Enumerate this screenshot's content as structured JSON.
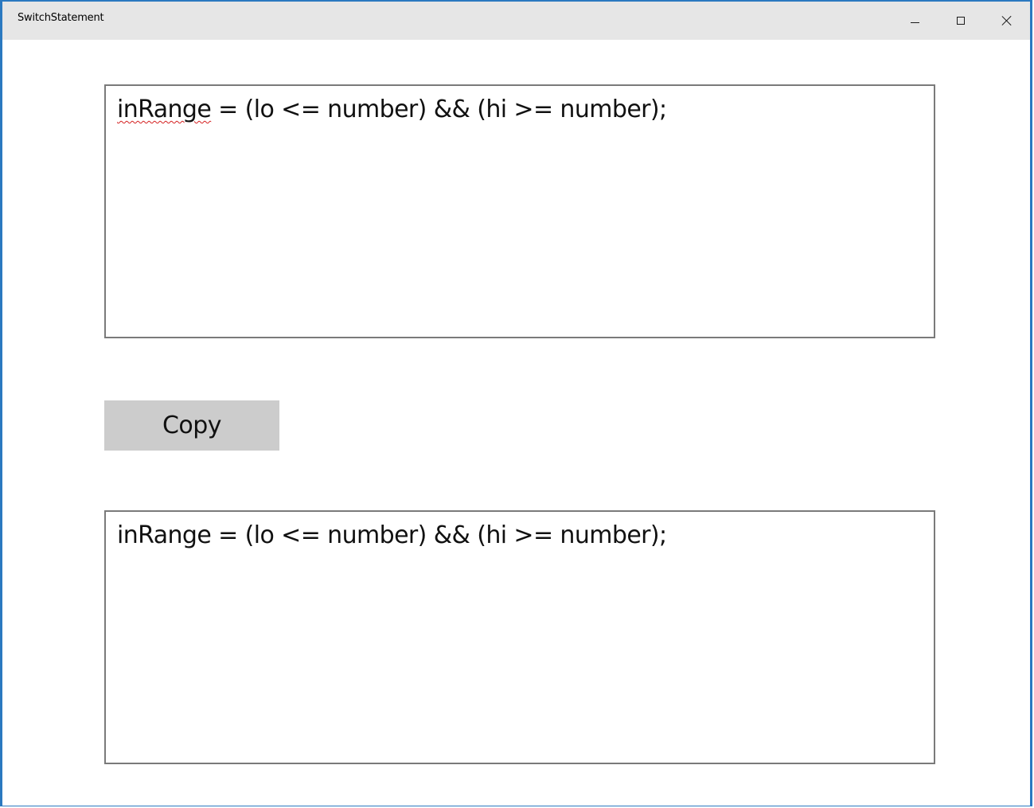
{
  "window": {
    "title": "SwitchStatement",
    "controls": {
      "minimize_icon": "minimize-icon",
      "maximize_icon": "maximize-icon",
      "close_icon": "close-icon"
    }
  },
  "input_box": {
    "prefix_word": "inRange",
    "rest": " = (lo <= number) && (hi >= number);"
  },
  "copy_button": {
    "label": "Copy"
  },
  "output_box": {
    "text": "inRange = (lo <= number) && (hi >= number);"
  },
  "colors": {
    "window_border": "#2b79c0",
    "titlebar_bg": "#e6e6e6",
    "button_bg": "#cccccc",
    "textbox_border": "#7a7a7a",
    "spellcheck_underline": "#d42020"
  }
}
